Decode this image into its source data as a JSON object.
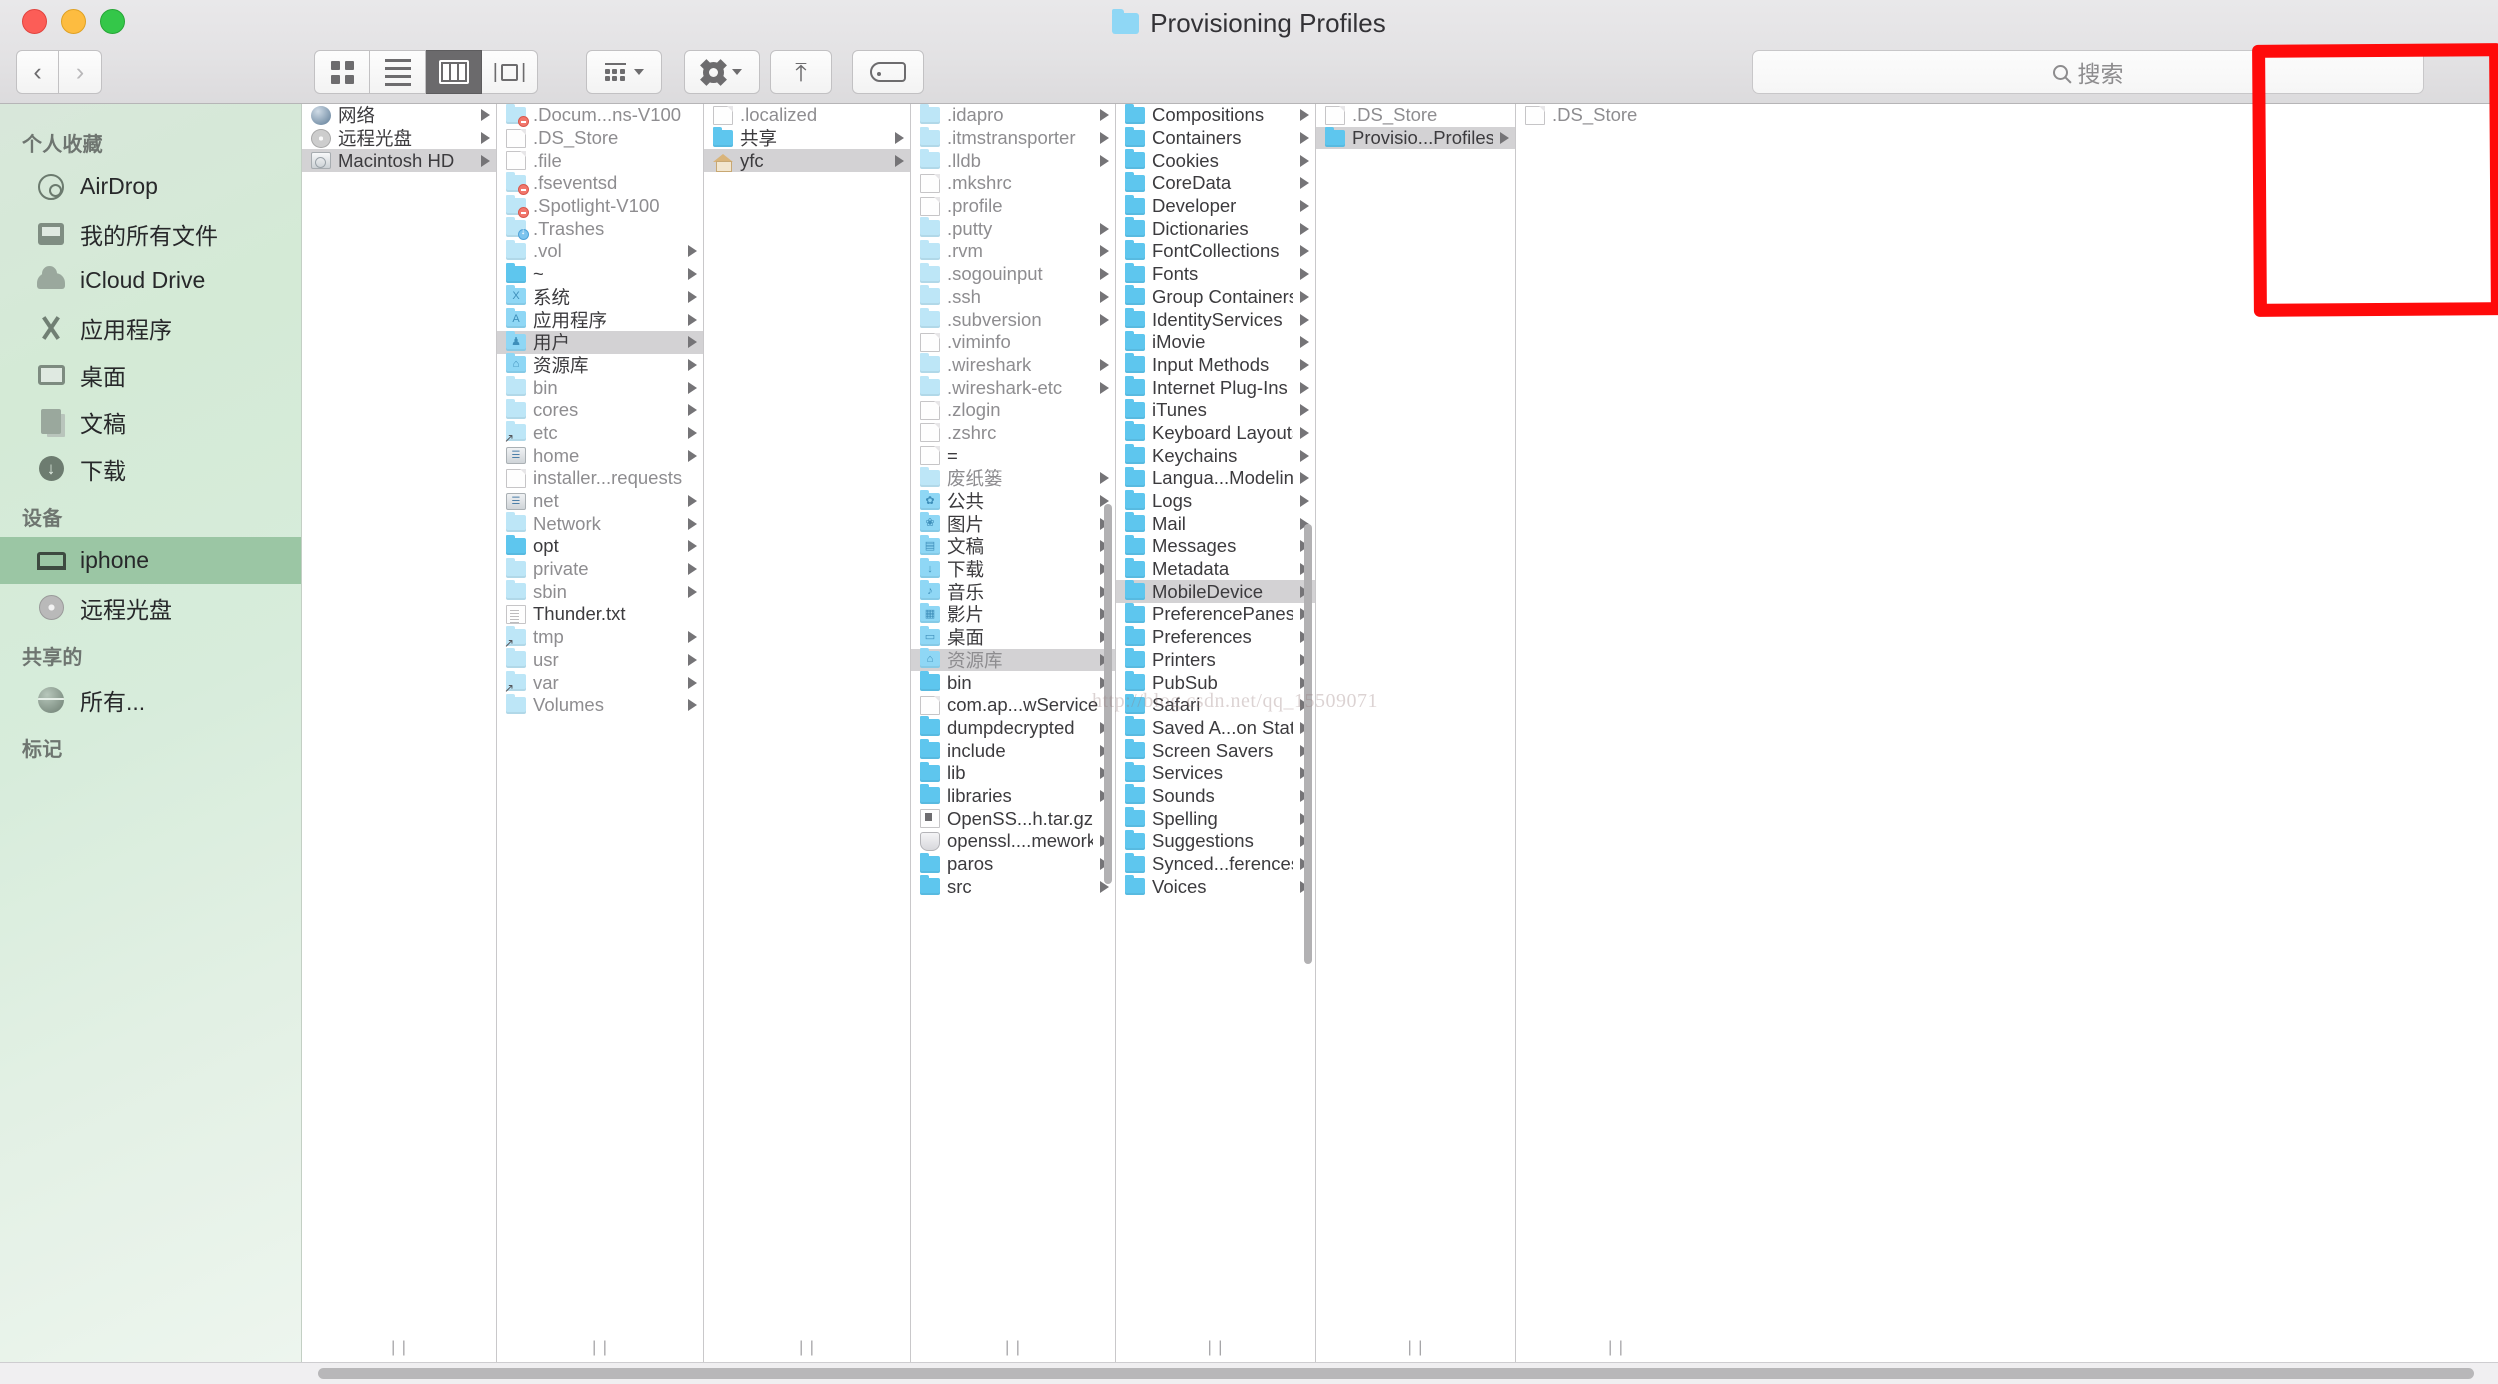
{
  "window": {
    "title": "Provisioning Profiles",
    "traffic_lights": [
      "close",
      "minimize",
      "zoom"
    ]
  },
  "toolbar": {
    "back_label": "‹",
    "forward_label": "›",
    "view_modes": [
      {
        "name": "icon-view",
        "selected": false
      },
      {
        "name": "list-view",
        "selected": false
      },
      {
        "name": "column-view",
        "selected": true
      },
      {
        "name": "cover-flow-view",
        "selected": false
      }
    ],
    "arrange_label": "",
    "action_label": "",
    "share_label": "",
    "tags_label": ""
  },
  "search": {
    "placeholder": "搜索",
    "value": ""
  },
  "sidebar": {
    "sections": [
      {
        "header": "个人收藏",
        "items": [
          {
            "label": "AirDrop",
            "icon": "airdrop-icon",
            "selected": false
          },
          {
            "label": "我的所有文件",
            "icon": "all-files-icon",
            "selected": false
          },
          {
            "label": "iCloud Drive",
            "icon": "cloud-icon",
            "selected": false
          },
          {
            "label": "应用程序",
            "icon": "applications-icon",
            "selected": false
          },
          {
            "label": "桌面",
            "icon": "desktop-icon",
            "selected": false
          },
          {
            "label": "文稿",
            "icon": "documents-icon",
            "selected": false
          },
          {
            "label": "下载",
            "icon": "downloads-icon",
            "selected": false
          }
        ]
      },
      {
        "header": "设备",
        "items": [
          {
            "label": "iphone",
            "icon": "laptop-icon",
            "selected": true
          },
          {
            "label": "远程光盘",
            "icon": "disc-icon",
            "selected": false
          }
        ]
      },
      {
        "header": "共享的",
        "items": [
          {
            "label": "所有...",
            "icon": "globe-icon",
            "selected": false
          }
        ]
      },
      {
        "header": "标记",
        "items": []
      }
    ]
  },
  "columns": [
    {
      "name": "devices-column",
      "rows": [
        {
          "label": "网络",
          "icon": "globe-sm",
          "arrow": true,
          "selected": false,
          "dim": false
        },
        {
          "label": "远程光盘",
          "icon": "disc-sm",
          "arrow": true,
          "selected": false,
          "dim": false
        },
        {
          "label": "Macintosh HD",
          "icon": "hdd",
          "arrow": true,
          "selected": true,
          "dim": false
        }
      ]
    },
    {
      "name": "root-column",
      "rows": [
        {
          "label": ".Docum...ns-V100",
          "icon": "folder-noaccess",
          "arrow": false,
          "selected": false,
          "dim": true
        },
        {
          "label": ".DS_Store",
          "icon": "doc",
          "arrow": false,
          "selected": false,
          "dim": true
        },
        {
          "label": ".file",
          "icon": "doc",
          "arrow": false,
          "selected": false,
          "dim": true
        },
        {
          "label": ".fseventsd",
          "icon": "folder-noaccess",
          "arrow": false,
          "selected": false,
          "dim": true
        },
        {
          "label": ".Spotlight-V100",
          "icon": "folder-noaccess",
          "arrow": false,
          "selected": false,
          "dim": true
        },
        {
          "label": ".Trashes",
          "icon": "folder-download",
          "arrow": false,
          "selected": false,
          "dim": true
        },
        {
          "label": ".vol",
          "icon": "folder",
          "arrow": true,
          "selected": false,
          "dim": true
        },
        {
          "label": "~",
          "icon": "folder-deep",
          "arrow": true,
          "selected": false,
          "dim": false
        },
        {
          "label": "系统",
          "icon": "folder-system",
          "arrow": true,
          "selected": false,
          "dim": false
        },
        {
          "label": "应用程序",
          "icon": "folder-apps",
          "arrow": true,
          "selected": false,
          "dim": false
        },
        {
          "label": "用户",
          "icon": "folder-users",
          "arrow": true,
          "selected": true,
          "dim": false
        },
        {
          "label": "资源库",
          "icon": "folder-library",
          "arrow": true,
          "selected": false,
          "dim": false
        },
        {
          "label": "bin",
          "icon": "folder",
          "arrow": true,
          "selected": false,
          "dim": true
        },
        {
          "label": "cores",
          "icon": "folder",
          "arrow": true,
          "selected": false,
          "dim": true
        },
        {
          "label": "etc",
          "icon": "folder-alias",
          "arrow": true,
          "selected": false,
          "dim": true
        },
        {
          "label": "home",
          "icon": "net",
          "arrow": true,
          "selected": false,
          "dim": true
        },
        {
          "label": "installer...requests",
          "icon": "doc",
          "arrow": false,
          "selected": false,
          "dim": true
        },
        {
          "label": "net",
          "icon": "net",
          "arrow": true,
          "selected": false,
          "dim": true
        },
        {
          "label": "Network",
          "icon": "folder",
          "arrow": true,
          "selected": false,
          "dim": true
        },
        {
          "label": "opt",
          "icon": "folder-deep",
          "arrow": true,
          "selected": false,
          "dim": false
        },
        {
          "label": "private",
          "icon": "folder",
          "arrow": true,
          "selected": false,
          "dim": true
        },
        {
          "label": "sbin",
          "icon": "folder",
          "arrow": true,
          "selected": false,
          "dim": true
        },
        {
          "label": "Thunder.txt",
          "icon": "txtdoc",
          "arrow": false,
          "selected": false,
          "dim": false
        },
        {
          "label": "tmp",
          "icon": "folder-alias",
          "arrow": true,
          "selected": false,
          "dim": true
        },
        {
          "label": "usr",
          "icon": "folder",
          "arrow": true,
          "selected": false,
          "dim": true
        },
        {
          "label": "var",
          "icon": "folder-alias",
          "arrow": true,
          "selected": false,
          "dim": true
        },
        {
          "label": "Volumes",
          "icon": "folder",
          "arrow": true,
          "selected": false,
          "dim": true
        }
      ]
    },
    {
      "name": "users-column",
      "rows": [
        {
          "label": ".localized",
          "icon": "doc",
          "arrow": false,
          "selected": false,
          "dim": true
        },
        {
          "label": "共享",
          "icon": "folder-deep",
          "arrow": true,
          "selected": false,
          "dim": false
        },
        {
          "label": "yfc",
          "icon": "home",
          "arrow": true,
          "selected": true,
          "dim": false
        }
      ]
    },
    {
      "name": "home-column",
      "rows": [
        {
          "label": ".idapro",
          "icon": "folder",
          "arrow": true,
          "selected": false,
          "dim": true
        },
        {
          "label": ".itmstransporter",
          "icon": "folder",
          "arrow": true,
          "selected": false,
          "dim": true
        },
        {
          "label": ".lldb",
          "icon": "folder",
          "arrow": true,
          "selected": false,
          "dim": true
        },
        {
          "label": ".mkshrc",
          "icon": "doc",
          "arrow": false,
          "selected": false,
          "dim": true
        },
        {
          "label": ".profile",
          "icon": "doc",
          "arrow": false,
          "selected": false,
          "dim": true
        },
        {
          "label": ".putty",
          "icon": "folder",
          "arrow": true,
          "selected": false,
          "dim": true
        },
        {
          "label": ".rvm",
          "icon": "folder",
          "arrow": true,
          "selected": false,
          "dim": true
        },
        {
          "label": ".sogouinput",
          "icon": "folder",
          "arrow": true,
          "selected": false,
          "dim": true
        },
        {
          "label": ".ssh",
          "icon": "folder",
          "arrow": true,
          "selected": false,
          "dim": true
        },
        {
          "label": ".subversion",
          "icon": "folder",
          "arrow": true,
          "selected": false,
          "dim": true
        },
        {
          "label": ".viminfo",
          "icon": "doc",
          "arrow": false,
          "selected": false,
          "dim": true
        },
        {
          "label": ".wireshark",
          "icon": "folder",
          "arrow": true,
          "selected": false,
          "dim": true
        },
        {
          "label": ".wireshark-etc",
          "icon": "folder",
          "arrow": true,
          "selected": false,
          "dim": true
        },
        {
          "label": ".zlogin",
          "icon": "doc",
          "arrow": false,
          "selected": false,
          "dim": true
        },
        {
          "label": ".zshrc",
          "icon": "doc",
          "arrow": false,
          "selected": false,
          "dim": true
        },
        {
          "label": "=",
          "icon": "doc",
          "arrow": false,
          "selected": false,
          "dim": false
        },
        {
          "label": "废纸篓",
          "icon": "folder",
          "arrow": true,
          "selected": false,
          "dim": true
        },
        {
          "label": "公共",
          "icon": "folder-public",
          "arrow": true,
          "selected": false,
          "dim": false
        },
        {
          "label": "图片",
          "icon": "folder-pictures",
          "arrow": true,
          "selected": false,
          "dim": false
        },
        {
          "label": "文稿",
          "icon": "folder-documents",
          "arrow": true,
          "selected": false,
          "dim": false
        },
        {
          "label": "下载",
          "icon": "folder-downloads",
          "arrow": true,
          "selected": false,
          "dim": false
        },
        {
          "label": "音乐",
          "icon": "folder-music",
          "arrow": true,
          "selected": false,
          "dim": false
        },
        {
          "label": "影片",
          "icon": "folder-movies",
          "arrow": true,
          "selected": false,
          "dim": false
        },
        {
          "label": "桌面",
          "icon": "folder-desktop",
          "arrow": true,
          "selected": false,
          "dim": false
        },
        {
          "label": "资源库",
          "icon": "folder-library",
          "arrow": true,
          "selected": true,
          "dim": true
        },
        {
          "label": "bin",
          "icon": "folder-deep",
          "arrow": true,
          "selected": false,
          "dim": false
        },
        {
          "label": "com.ap...wService",
          "icon": "doc",
          "arrow": false,
          "selected": false,
          "dim": false
        },
        {
          "label": "dumpdecrypted",
          "icon": "folder-deep",
          "arrow": true,
          "selected": false,
          "dim": false
        },
        {
          "label": "include",
          "icon": "folder-deep",
          "arrow": true,
          "selected": false,
          "dim": false
        },
        {
          "label": "lib",
          "icon": "folder-deep",
          "arrow": true,
          "selected": false,
          "dim": false
        },
        {
          "label": "libraries",
          "icon": "folder-deep",
          "arrow": true,
          "selected": false,
          "dim": false
        },
        {
          "label": "OpenSS...h.tar.gz",
          "icon": "gzdoc",
          "arrow": false,
          "selected": false,
          "dim": false
        },
        {
          "label": "openssl....mework",
          "icon": "shield",
          "arrow": true,
          "selected": false,
          "dim": false
        },
        {
          "label": "paros",
          "icon": "folder-deep",
          "arrow": true,
          "selected": false,
          "dim": false
        },
        {
          "label": "src",
          "icon": "folder-deep",
          "arrow": true,
          "selected": false,
          "dim": false
        }
      ]
    },
    {
      "name": "library-column",
      "rows": [
        {
          "label": "Compositions",
          "icon": "folder-deep",
          "arrow": true,
          "selected": false,
          "dim": false
        },
        {
          "label": "Containers",
          "icon": "folder-deep",
          "arrow": true,
          "selected": false,
          "dim": false
        },
        {
          "label": "Cookies",
          "icon": "folder-deep",
          "arrow": true,
          "selected": false,
          "dim": false
        },
        {
          "label": "CoreData",
          "icon": "folder-deep",
          "arrow": true,
          "selected": false,
          "dim": false
        },
        {
          "label": "Developer",
          "icon": "folder-deep",
          "arrow": true,
          "selected": false,
          "dim": false
        },
        {
          "label": "Dictionaries",
          "icon": "folder-deep",
          "arrow": true,
          "selected": false,
          "dim": false
        },
        {
          "label": "FontCollections",
          "icon": "folder-deep",
          "arrow": true,
          "selected": false,
          "dim": false
        },
        {
          "label": "Fonts",
          "icon": "folder-deep",
          "arrow": true,
          "selected": false,
          "dim": false
        },
        {
          "label": "Group Containers",
          "icon": "folder-deep",
          "arrow": true,
          "selected": false,
          "dim": false
        },
        {
          "label": "IdentityServices",
          "icon": "folder-deep",
          "arrow": true,
          "selected": false,
          "dim": false
        },
        {
          "label": "iMovie",
          "icon": "folder-deep",
          "arrow": true,
          "selected": false,
          "dim": false
        },
        {
          "label": "Input Methods",
          "icon": "folder-deep",
          "arrow": true,
          "selected": false,
          "dim": false
        },
        {
          "label": "Internet Plug-Ins",
          "icon": "folder-deep",
          "arrow": true,
          "selected": false,
          "dim": false
        },
        {
          "label": "iTunes",
          "icon": "folder-deep",
          "arrow": true,
          "selected": false,
          "dim": false
        },
        {
          "label": "Keyboard Layouts",
          "icon": "folder-deep",
          "arrow": true,
          "selected": false,
          "dim": false
        },
        {
          "label": "Keychains",
          "icon": "folder-deep",
          "arrow": true,
          "selected": false,
          "dim": false
        },
        {
          "label": "Langua...Modeling",
          "icon": "folder-deep",
          "arrow": true,
          "selected": false,
          "dim": false
        },
        {
          "label": "Logs",
          "icon": "folder-deep",
          "arrow": true,
          "selected": false,
          "dim": false
        },
        {
          "label": "Mail",
          "icon": "folder-deep",
          "arrow": true,
          "selected": false,
          "dim": false
        },
        {
          "label": "Messages",
          "icon": "folder-deep",
          "arrow": true,
          "selected": false,
          "dim": false
        },
        {
          "label": "Metadata",
          "icon": "folder-deep",
          "arrow": true,
          "selected": false,
          "dim": false
        },
        {
          "label": "MobileDevice",
          "icon": "folder-deep",
          "arrow": true,
          "selected": true,
          "dim": false
        },
        {
          "label": "PreferencePanes",
          "icon": "folder-deep",
          "arrow": true,
          "selected": false,
          "dim": false
        },
        {
          "label": "Preferences",
          "icon": "folder-deep",
          "arrow": true,
          "selected": false,
          "dim": false
        },
        {
          "label": "Printers",
          "icon": "folder-deep",
          "arrow": true,
          "selected": false,
          "dim": false
        },
        {
          "label": "PubSub",
          "icon": "folder-deep",
          "arrow": true,
          "selected": false,
          "dim": false
        },
        {
          "label": "Safari",
          "icon": "folder-deep",
          "arrow": true,
          "selected": false,
          "dim": false
        },
        {
          "label": "Saved A...on State",
          "icon": "folder-deep",
          "arrow": true,
          "selected": false,
          "dim": false
        },
        {
          "label": "Screen Savers",
          "icon": "folder-deep",
          "arrow": true,
          "selected": false,
          "dim": false
        },
        {
          "label": "Services",
          "icon": "folder-deep",
          "arrow": true,
          "selected": false,
          "dim": false
        },
        {
          "label": "Sounds",
          "icon": "folder-deep",
          "arrow": true,
          "selected": false,
          "dim": false
        },
        {
          "label": "Spelling",
          "icon": "folder-deep",
          "arrow": true,
          "selected": false,
          "dim": false
        },
        {
          "label": "Suggestions",
          "icon": "folder-deep",
          "arrow": true,
          "selected": false,
          "dim": false
        },
        {
          "label": "Synced...ferences",
          "icon": "folder-deep",
          "arrow": true,
          "selected": false,
          "dim": false
        },
        {
          "label": "Voices",
          "icon": "folder-deep",
          "arrow": true,
          "selected": false,
          "dim": false
        }
      ]
    },
    {
      "name": "mobiledevice-column",
      "rows": [
        {
          "label": ".DS_Store",
          "icon": "doc",
          "arrow": false,
          "selected": false,
          "dim": true
        },
        {
          "label": "Provisio...Profiles",
          "icon": "folder-deep",
          "arrow": true,
          "selected": true,
          "dim": false
        }
      ]
    },
    {
      "name": "provisioning-profiles-column",
      "rows": [
        {
          "label": ".DS_Store",
          "icon": "doc",
          "arrow": false,
          "selected": false,
          "dim": true
        }
      ]
    }
  ],
  "annotation": {
    "shape": "red-rectangle",
    "color": "#ff0a0a",
    "target": "provisioning-profiles-column"
  },
  "watermark": {
    "text": "http://blog.csdn.net/qq_15509071"
  },
  "grip_label": "| |"
}
